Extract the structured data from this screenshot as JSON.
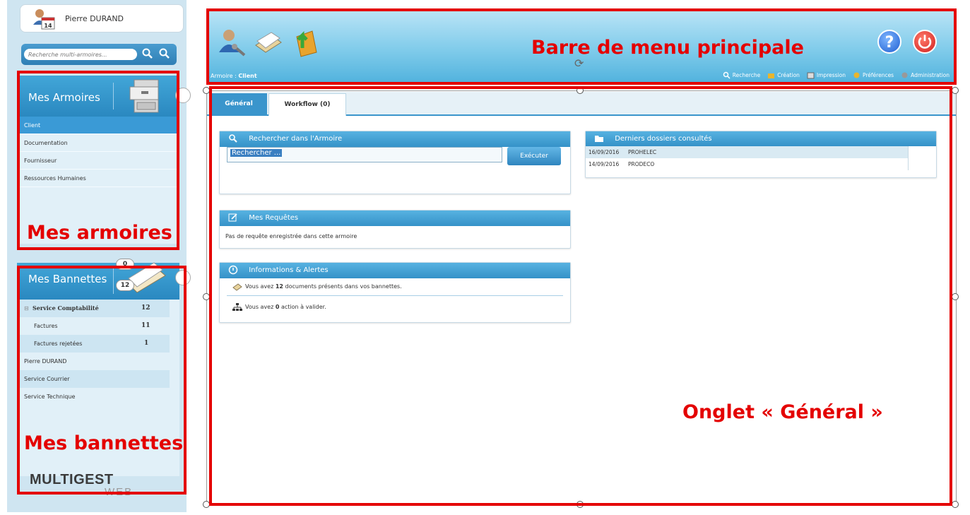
{
  "user": {
    "name": "Pierre DURAND",
    "calendar_day": "14"
  },
  "multi_search": {
    "placeholder": "Recherche multi-armoires..."
  },
  "armoires": {
    "title": "Mes Armoires",
    "items": [
      "Client",
      "Documentation",
      "Fournisseur",
      "Ressources Humaines"
    ],
    "selected": "Client"
  },
  "bannettes": {
    "title": "Mes Bannettes",
    "badge_top": "0",
    "badge_bottom": "12",
    "groups": [
      {
        "label": "Service Comptabilité",
        "count": "12",
        "expand_symbol": "⊟"
      },
      {
        "label": "Factures",
        "count": "11"
      },
      {
        "label": "Factures rejetées",
        "count": "1"
      },
      {
        "label": "Pierre DURAND"
      },
      {
        "label": "Service Courrier"
      },
      {
        "label": "Service Technique"
      }
    ]
  },
  "logo": {
    "main": "MULTIGEST",
    "sub": "WEB"
  },
  "topbar": {
    "breadcrumb_prefix": "Armoire : ",
    "breadcrumb_value": "Client",
    "links": [
      "Recherche",
      "Création",
      "Impression",
      "Préférences",
      "Administration"
    ]
  },
  "tabs": [
    {
      "label": "Général",
      "active": true
    },
    {
      "label": "Workflow (0)",
      "active": false
    }
  ],
  "search_panel": {
    "title": "Rechercher dans l'Armoire",
    "input_value": "Rechercher ...",
    "button_label": "Exécuter"
  },
  "requetes_panel": {
    "title": "Mes Requêtes",
    "text": "Pas de requête enregistrée dans cette armoire"
  },
  "info_panel": {
    "title": "Informations & Alertes",
    "line1_pre": "Vous avez ",
    "line1_num": "12",
    "line1_post": " documents présents dans vos bannettes.",
    "line2_pre": "Vous avez ",
    "line2_num": "0",
    "line2_post": " action à valider."
  },
  "recent_panel": {
    "title": "Derniers dossiers consultés",
    "rows": [
      {
        "date": "16/09/2016",
        "name": "PROHELEC"
      },
      {
        "date": "14/09/2016",
        "name": "PRODECO"
      }
    ]
  },
  "annotations": {
    "menu": "Barre de menu principale",
    "armoires": "Mes armoires",
    "bannettes": "Mes bannettes",
    "onglet": "Onglet « Général »"
  },
  "colors": {
    "accent": "#3a95cc",
    "annotation": "#e40000",
    "header_blue": "#42a6d8"
  }
}
